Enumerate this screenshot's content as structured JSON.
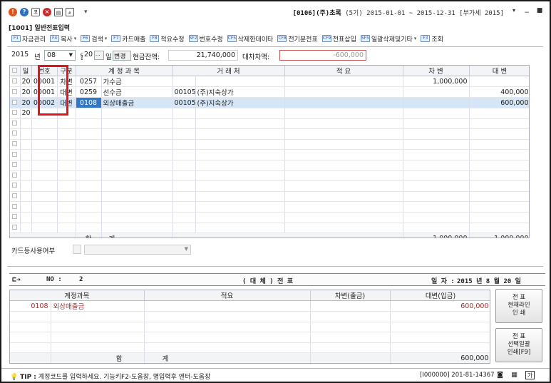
{
  "titlebar": {
    "company_code": "[0106]",
    "company_name": "(주)초록",
    "company_info": "(5기) 2015-01-01 ~ 2015-12-31 [부가세 2015]"
  },
  "program": {
    "title": "[1001] 일반전표입력"
  },
  "toolbar": {
    "items": [
      {
        "key": "F1",
        "label": "자금관리",
        "dropdown": false
      },
      {
        "key": "F4",
        "label": "복사",
        "dropdown": true
      },
      {
        "key": "F6",
        "label": "검색",
        "dropdown": true
      },
      {
        "key": "F7",
        "label": "카드매출",
        "dropdown": false
      },
      {
        "key": "F8",
        "label": "적요수정",
        "dropdown": false
      },
      {
        "key": "SF2",
        "label": "번호수정",
        "dropdown": false
      },
      {
        "key": "CF5",
        "label": "삭제한데이타",
        "dropdown": false
      },
      {
        "key": "CF8",
        "label": "전기분전표",
        "dropdown": false
      },
      {
        "key": "CF9",
        "label": "전표삽입",
        "dropdown": false
      },
      {
        "key": "SF5",
        "label": "일괄삭제및기타",
        "dropdown": true
      },
      {
        "key": "F3",
        "label": "조회",
        "dropdown": false
      }
    ]
  },
  "date": {
    "year": "2015",
    "year_unit": "년",
    "month": "08",
    "month_unit": "월",
    "day": "20",
    "day_btn": "...",
    "day_unit": "일",
    "change_btn": "변경",
    "cash_label": "현금잔액:",
    "cash_value": "21,740,000",
    "diff_label": "대차차액:",
    "diff_value": "-600,000"
  },
  "grid": {
    "headers": [
      "일",
      "번호",
      "구분",
      "계 정 과 목",
      "거 래 처",
      "적 요",
      "차 변",
      "대 변"
    ],
    "rows": [
      {
        "day": "20",
        "no": "00001",
        "type": "차변",
        "acct_code": "0257",
        "acct_name": "가수금",
        "cust_code": "",
        "cust_name": "",
        "memo": "",
        "debit": "1,000,000",
        "credit": ""
      },
      {
        "day": "20",
        "no": "00001",
        "type": "대변",
        "acct_code": "0259",
        "acct_name": "선수금",
        "cust_code": "00105",
        "cust_name": "(주)지숙상가",
        "memo": "",
        "debit": "",
        "credit": "400,000"
      },
      {
        "day": "20",
        "no": "00002",
        "type": "대변",
        "acct_code": "0108",
        "acct_name": "외상매출금",
        "cust_code": "00105",
        "cust_name": "(주)지숙상가",
        "memo": "",
        "debit": "",
        "credit": "600,000"
      },
      {
        "day": "20",
        "no": "",
        "type": "",
        "acct_code": "",
        "acct_name": "",
        "cust_code": "",
        "cust_name": "",
        "memo": "",
        "debit": "",
        "credit": ""
      }
    ],
    "total_label": "합",
    "total_label2": "계",
    "total_debit": "1,000,000",
    "total_credit": "1,000,000"
  },
  "card": {
    "label": "카드등사용여부"
  },
  "voucher": {
    "no_label": "NO :",
    "no": "2",
    "title": "( 대 체 ) 전 표",
    "date_label": "일 자 :",
    "date": "2015 년 8 월 20 일"
  },
  "vgrid": {
    "headers": [
      "계정과목",
      "적요",
      "차변(출금)",
      "대변(입금)"
    ],
    "rows": [
      {
        "acct_code": "0108",
        "acct_name": "외상매출금",
        "memo": "",
        "debit": "",
        "credit": "600,000"
      }
    ],
    "total_label": "합",
    "total_label2": "계",
    "total_debit": "",
    "total_credit": "600,000"
  },
  "buttons": {
    "print_current": "전 표\n현재라인\n인 쇄",
    "print_selected": "전 표\n선택일괄\n인쇄[F9]"
  },
  "status": {
    "tip_label": "TIP :",
    "tip": "계정코드를 입력하세요. 기능키F2-도움창, 명입력후 엔터-도움창",
    "user": "[I000000]",
    "biz_no": "201-81-14367",
    "lang_btn": "가"
  }
}
